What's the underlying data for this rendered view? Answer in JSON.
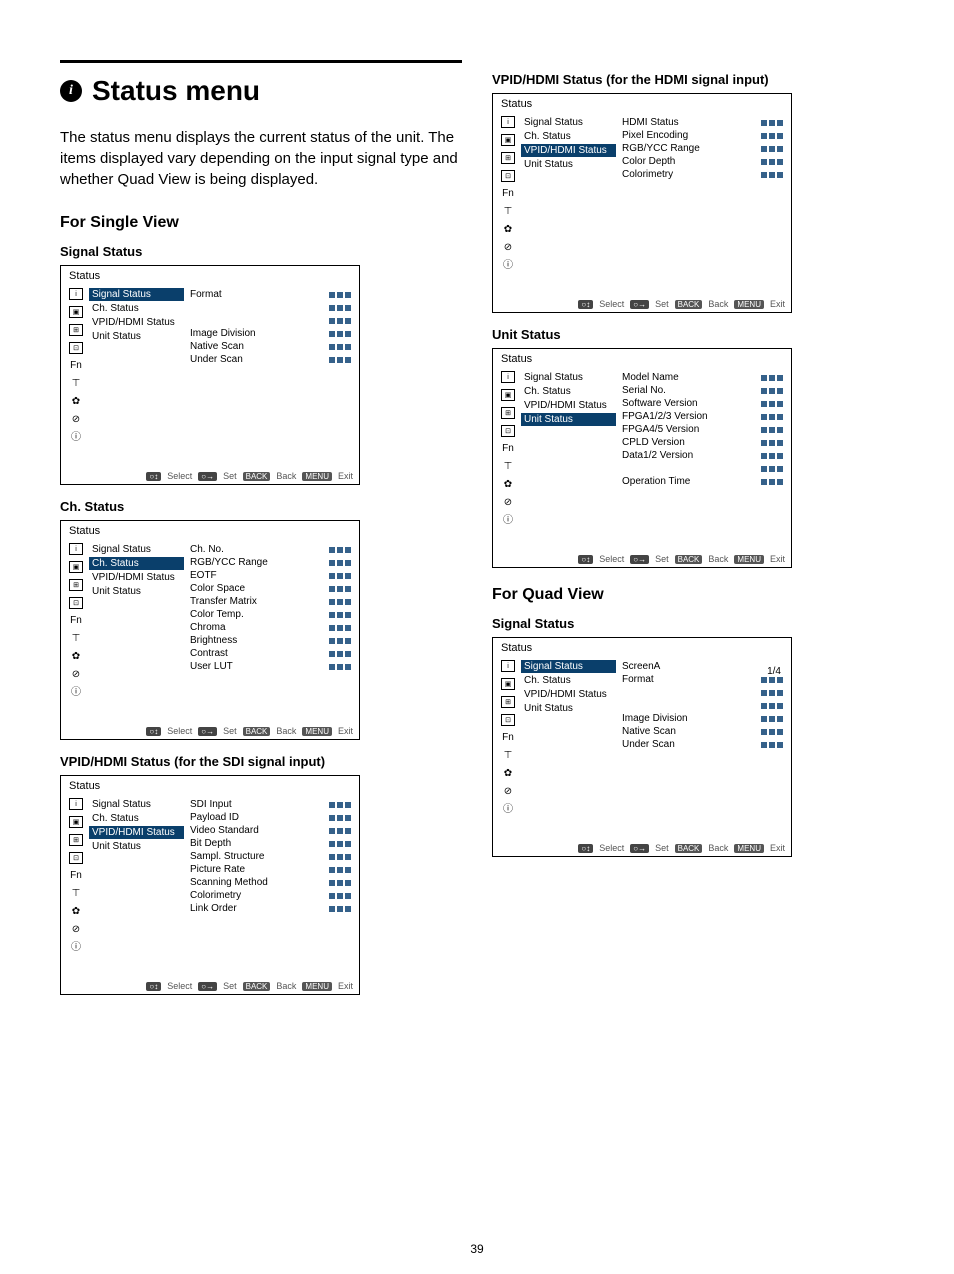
{
  "page_number": "39",
  "title_section": {
    "icon_char": "i",
    "heading": "Status menu",
    "description": "The status menu displays the current status of the unit. The items displayed vary depending on the input signal type and whether Quad View is being displayed."
  },
  "single_view": {
    "heading": "For Single View",
    "signal_status": {
      "heading": "Signal Status",
      "menu_title": "Status",
      "side_items": [
        "Signal Status",
        "Ch. Status",
        "VPID/HDMI Status",
        "Unit Status"
      ],
      "selected_index": 0,
      "fields": [
        "Format",
        "",
        "",
        "Image Division",
        "Native Scan",
        "Under Scan"
      ]
    },
    "ch_status": {
      "heading": "Ch. Status",
      "menu_title": "Status",
      "side_items": [
        "Signal Status",
        "Ch. Status",
        "VPID/HDMI Status",
        "Unit Status"
      ],
      "selected_index": 1,
      "fields": [
        "Ch. No.",
        "RGB/YCC Range",
        "EOTF",
        "Color Space",
        "Transfer Matrix",
        "Color Temp.",
        "Chroma",
        "Brightness",
        "Contrast",
        "User LUT"
      ]
    },
    "vpid_sdi": {
      "heading": "VPID/HDMI Status (for the SDI signal input)",
      "menu_title": "Status",
      "side_items": [
        "Signal Status",
        "Ch. Status",
        "VPID/HDMI Status",
        "Unit Status"
      ],
      "selected_index": 2,
      "fields": [
        "SDI Input",
        "Payload ID",
        "Video Standard",
        "Bit Depth",
        "Sampl. Structure",
        "Picture Rate",
        "Scanning Method",
        "Colorimetry",
        "Link Order"
      ]
    }
  },
  "quad_view": {
    "heading": "For Quad View",
    "vpid_hdmi": {
      "heading": "VPID/HDMI Status (for the HDMI signal input)",
      "menu_title": "Status",
      "side_items": [
        "Signal Status",
        "Ch. Status",
        "VPID/HDMI Status",
        "Unit Status"
      ],
      "selected_index": 2,
      "fields": [
        "HDMI Status",
        "Pixel Encoding",
        "RGB/YCC Range",
        "Color Depth",
        "Colorimetry"
      ]
    },
    "unit_status": {
      "heading": "Unit Status",
      "menu_title": "Status",
      "side_items": [
        "Signal Status",
        "Ch. Status",
        "VPID/HDMI Status",
        "Unit Status"
      ],
      "selected_index": 3,
      "fields": [
        "Model Name",
        "Serial No.",
        "Software Version",
        "FPGA1/2/3 Version",
        "FPGA4/5 Version",
        "CPLD Version",
        "Data1/2 Version",
        "",
        "Operation Time"
      ]
    },
    "signal_status": {
      "heading": "Signal Status",
      "menu_title": "Status",
      "page_indicator": "1/4",
      "side_items": [
        "Signal Status",
        "Ch. Status",
        "VPID/HDMI Status",
        "Unit Status"
      ],
      "selected_index": 0,
      "screen_label": "ScreenA",
      "fields": [
        "Format",
        "",
        "",
        "Image Division",
        "Native Scan",
        "Under Scan"
      ]
    }
  },
  "footer": {
    "select_chip": "○↕",
    "select_label": "Select",
    "set_chip": "○→",
    "set_label": "Set",
    "back_chip": "BACK",
    "back_label": "Back",
    "menu_chip": "MENU",
    "exit_label": "Exit"
  }
}
